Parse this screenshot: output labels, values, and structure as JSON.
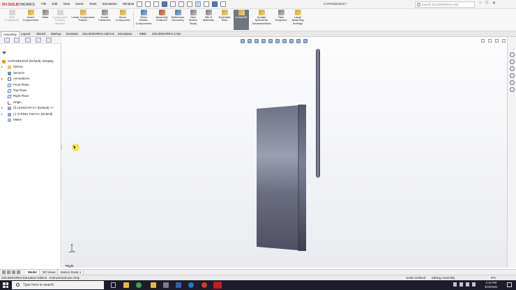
{
  "app": {
    "logo_ds": "DS",
    "logo_brand": "SOLID",
    "logo_brand2": "WORKS",
    "document_title": "CAPANDLENS *",
    "search_placeholder": "Search SOLIDWORKS Help",
    "window_controls": [
      "–",
      "□",
      "✕"
    ]
  },
  "menu": [
    "File",
    "Edit",
    "View",
    "Insert",
    "Tools",
    "Simulation",
    "Window"
  ],
  "commands": [
    {
      "line1": "Edit",
      "line2": "Component",
      "line3": "",
      "disabled": true,
      "icon": "edit-component-icon"
    },
    {
      "line1": "Insert",
      "line2": "Components",
      "line3": "",
      "disabled": false,
      "icon": "insert-components-icon"
    },
    {
      "line1": "Mate",
      "line2": "",
      "line3": "",
      "disabled": false,
      "icon": "mate-icon"
    },
    {
      "line1": "Component",
      "line2": "Preview",
      "line3": "Window",
      "disabled": true,
      "icon": "component-preview-icon"
    },
    {
      "line1": "Linear Component",
      "line2": "Pattern",
      "line3": "",
      "disabled": false,
      "icon": "linear-pattern-icon"
    },
    {
      "line1": "Smart",
      "line2": "Fasteners",
      "line3": "",
      "disabled": false,
      "icon": "smart-fasteners-icon"
    },
    {
      "line1": "Move",
      "line2": "Component",
      "line3": "",
      "disabled": false,
      "icon": "move-component-icon"
    },
    {
      "line1": "Show",
      "line2": "Hidden",
      "line3": "Components",
      "disabled": false,
      "icon": "show-hidden-icon"
    },
    {
      "line1": "Assembly",
      "line2": "Features",
      "line3": "",
      "disabled": false,
      "icon": "assembly-features-icon"
    },
    {
      "line1": "Reference",
      "line2": "Geometry",
      "line3": "",
      "disabled": false,
      "icon": "reference-geometry-icon"
    },
    {
      "line1": "New",
      "line2": "Motion",
      "line3": "Study",
      "disabled": false,
      "icon": "motion-study-icon"
    },
    {
      "line1": "Bill of",
      "line2": "Materials",
      "line3": "",
      "disabled": false,
      "icon": "bom-icon"
    },
    {
      "line1": "Exploded",
      "line2": "View",
      "line3": "",
      "disabled": false,
      "icon": "exploded-view-icon"
    },
    {
      "line1": "Instant3D",
      "line2": "",
      "line3": "",
      "disabled": false,
      "icon": "instant3d-icon"
    },
    {
      "line1": "Update",
      "line2": "SpeedPak",
      "line3": "Subassemblies",
      "disabled": false,
      "icon": "speedpak-icon"
    },
    {
      "line1": "Take",
      "line2": "Snapshot",
      "line3": "",
      "disabled": false,
      "icon": "snapshot-icon"
    },
    {
      "line1": "Large",
      "line2": "Assembly",
      "line3": "Settings",
      "disabled": false,
      "icon": "large-assembly-icon"
    }
  ],
  "tabs": [
    "Assembly",
    "Layout",
    "Sketch",
    "Markup",
    "Evaluate",
    "SOLIDWORKS Add-Ins",
    "Simulation",
    "MBD",
    "SOLIDWORKS CAM"
  ],
  "tree": [
    {
      "label": "CAPANDLENS (Default) <Display",
      "icon": "assembly-icon",
      "indent": 0,
      "arrow": false
    },
    {
      "label": "History",
      "icon": "history-icon",
      "indent": 1,
      "arrow": true
    },
    {
      "label": "Sensors",
      "icon": "sensors-icon",
      "indent": 1,
      "arrow": false
    },
    {
      "label": "Annotations",
      "icon": "annotations-icon",
      "indent": 1,
      "arrow": true
    },
    {
      "label": "Front Plane",
      "icon": "plane-icon",
      "indent": 1,
      "arrow": false
    },
    {
      "label": "Top Plane",
      "icon": "plane-icon",
      "indent": 1,
      "arrow": false
    },
    {
      "label": "Right Plane",
      "icon": "plane-icon",
      "indent": 1,
      "arrow": false
    },
    {
      "label": "Origin",
      "icon": "origin-icon",
      "indent": 1,
      "arrow": false
    },
    {
      "label": "(f) LENSCAP<1> (Default) <<",
      "icon": "part-icon",
      "indent": 1,
      "arrow": true
    },
    {
      "label": "(-) O-RING Part<1> (Default)",
      "icon": "part-icon",
      "indent": 1,
      "arrow": true
    },
    {
      "label": "Mates",
      "icon": "mates-icon",
      "indent": 1,
      "arrow": false
    }
  ],
  "viewport": {
    "view_label": "*Right"
  },
  "model_tabs": [
    "Model",
    "3D Views",
    "Motion Study 1"
  ],
  "status": {
    "edition": "SOLIDWORKS Education Edition - Instructional Use Only",
    "state": "Under Defined",
    "mode": "Editing Assembly",
    "units": "IPS"
  },
  "taskbar": {
    "search_placeholder": "Type here to search",
    "time": "2:16 PM",
    "date": "3/20/2021"
  },
  "colors": {
    "accent": "#d01c1f",
    "taskbar": "#1c1c2b",
    "active_cmd": "#6f7682"
  }
}
